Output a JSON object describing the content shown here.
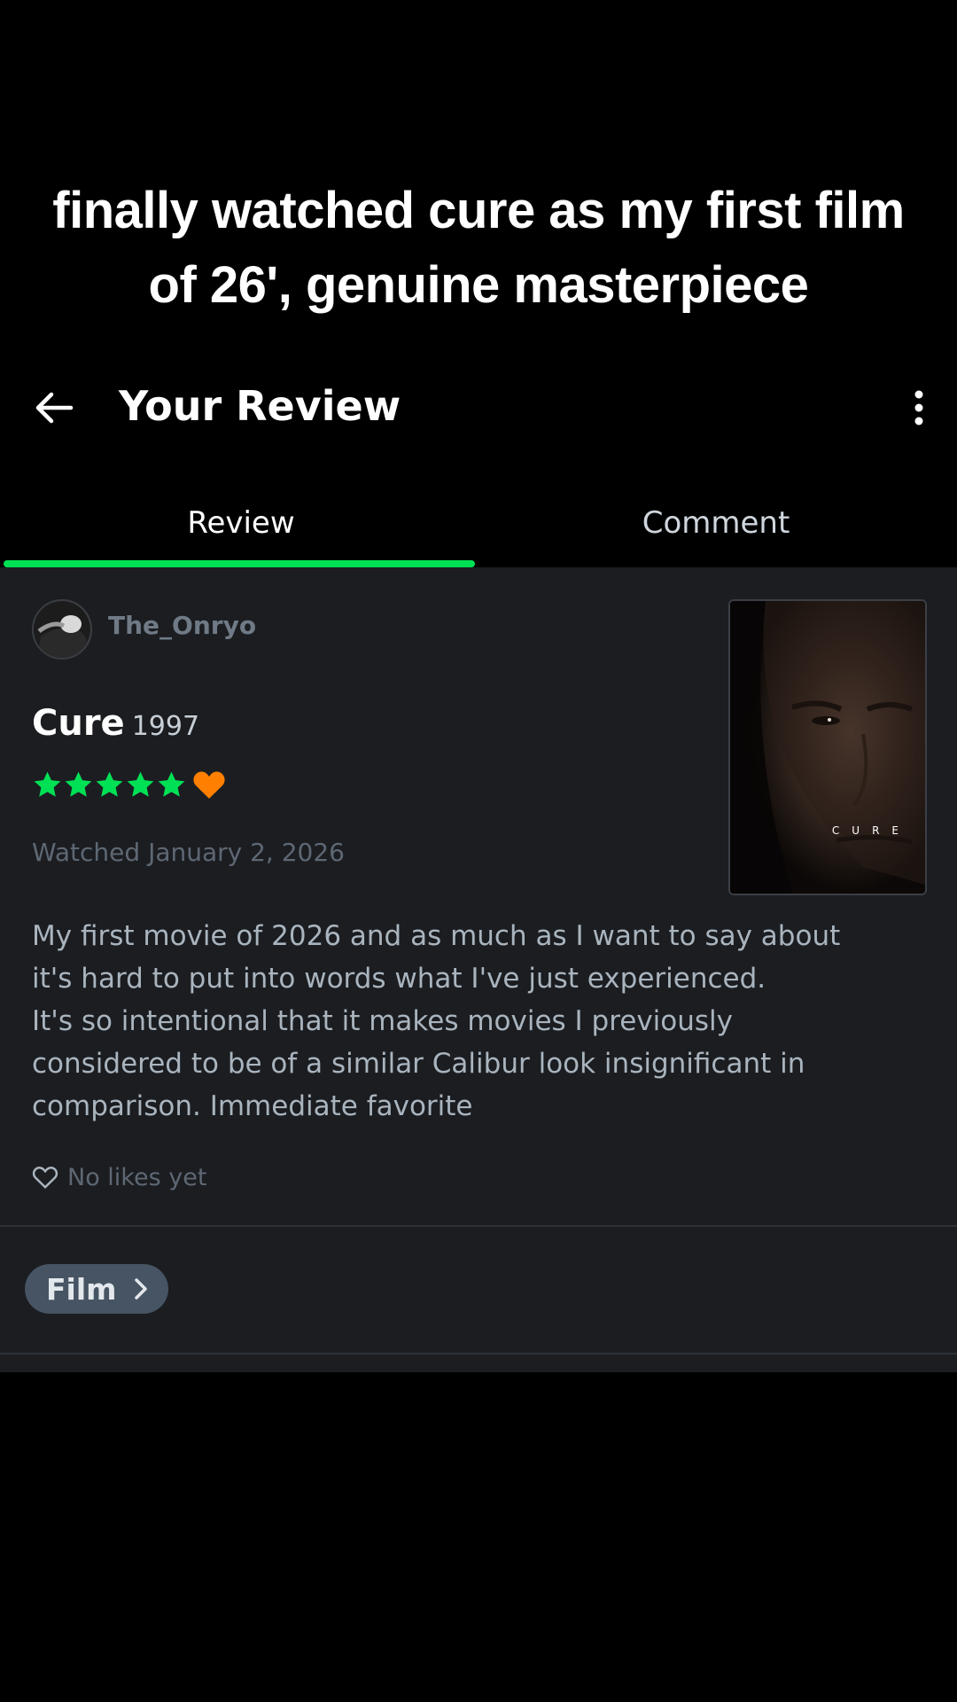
{
  "caption": {
    "line1": "finally watched cure as my first film",
    "line2": "of 26', genuine masterpiece"
  },
  "header": {
    "back_icon": "arrow-left-icon",
    "title": "Your Review",
    "menu_icon": "more-vertical-icon"
  },
  "tabs": {
    "review": "Review",
    "comment": "Comment",
    "active": "Review",
    "indicator_color": "#00e054"
  },
  "review": {
    "username": "The_Onryo",
    "film_title": "Cure",
    "film_year": "1997",
    "rating_stars": 5,
    "liked": true,
    "star_color": "#00e054",
    "heart_color": "#ff8000",
    "watched": "Watched January 2, 2026",
    "poster_title": "CURE",
    "text_lines": [
      "My first movie of 2026 and as much as I want to say about",
      "it's hard to put into words what I've just experienced.",
      "It's so intentional that it makes movies I previously",
      "considered to be of a similar Calibur look insignificant in",
      "comparison. Immediate favorite"
    ],
    "likes_label": "No likes yet"
  },
  "chip": {
    "label": "Film",
    "icon": "chevron-right-icon"
  }
}
